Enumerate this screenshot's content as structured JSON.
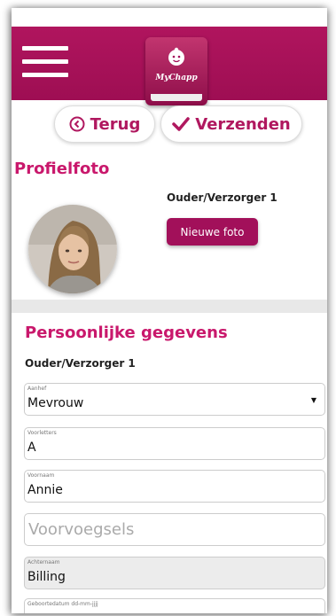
{
  "app": {
    "logo_text": "MyChapp",
    "brand_color": "#a3105a",
    "accent_color": "#c9186c"
  },
  "toolbar": {
    "menu_icon": "hamburger-menu-icon",
    "back_label": "Terug",
    "back_icon": "circle-chevron-left-icon",
    "send_label": "Verzenden",
    "send_icon": "checkmark-icon"
  },
  "profile_photo": {
    "heading": "Profielfoto",
    "parent_label": "Ouder/Verzorger 1",
    "new_photo_button": "Nieuwe foto"
  },
  "personal": {
    "heading": "Persoonlijke gegevens",
    "parent_label": "Ouder/Verzorger 1",
    "fields": {
      "aanhef": {
        "label": "Aanhef",
        "value": "Mevrouw"
      },
      "voorletters": {
        "label": "Voorletters",
        "value": "A"
      },
      "voornaam": {
        "label": "Voornaam",
        "value": "Annie"
      },
      "voorvoegsels": {
        "placeholder": "Voorvoegsels"
      },
      "achternaam": {
        "label": "Achternaam",
        "value": "Billing"
      },
      "geboortedatum": {
        "label": "Geboortedatum dd-mm-jjjj"
      }
    }
  }
}
